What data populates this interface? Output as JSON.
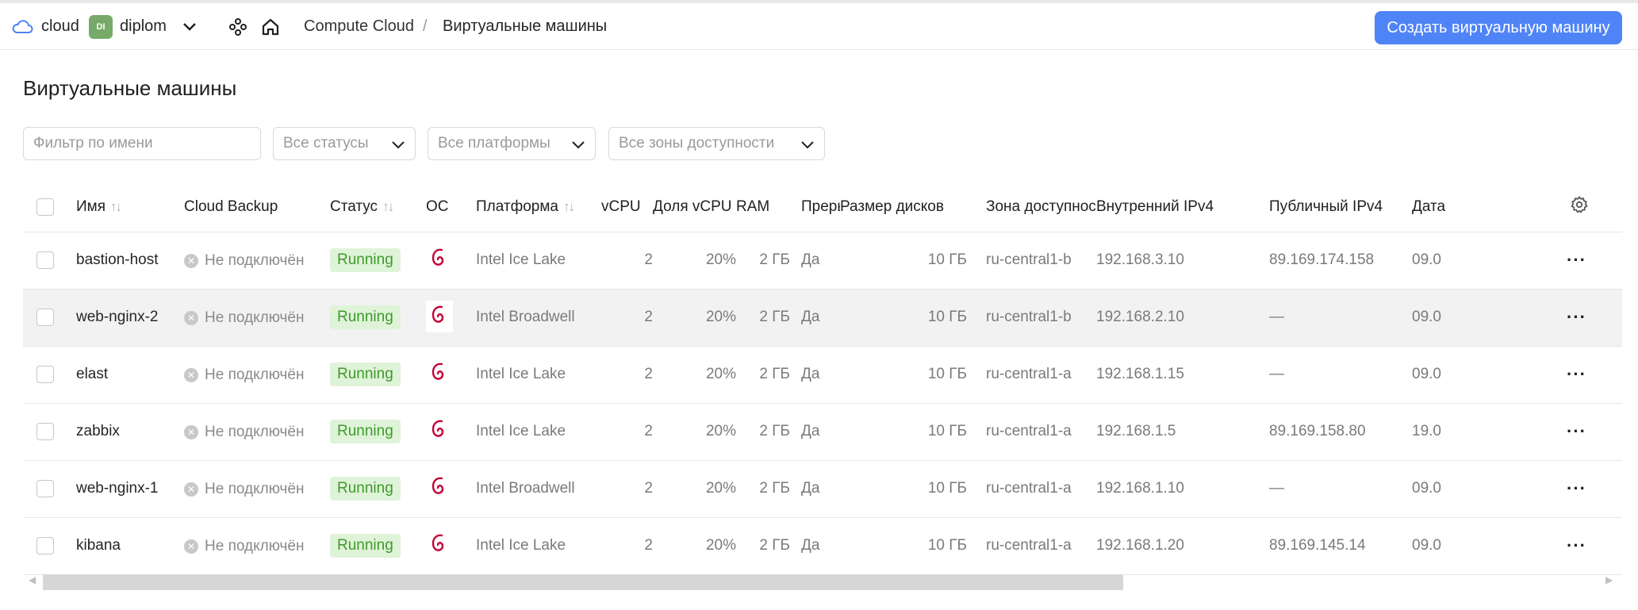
{
  "header": {
    "cloud_label": "cloud",
    "folder_badge": "DI",
    "folder_label": "diplom",
    "breadcrumb_service": "Compute Cloud",
    "breadcrumb_sep": "/",
    "breadcrumb_current": "Виртуальные машины",
    "create_button": "Создать виртуальную машину"
  },
  "page": {
    "title": "Виртуальные машины"
  },
  "filters": {
    "name_placeholder": "Фильтр по имени",
    "status": "Все статусы",
    "platform": "Все платформы",
    "zone": "Все зоны доступности"
  },
  "table": {
    "columns": {
      "name": "Имя",
      "backup": "Cloud Backup",
      "status": "Статус",
      "os": "ОС",
      "platform": "Платформа",
      "vcpu": "vCPU",
      "vcpu_share": "Доля vCPU",
      "ram": "RAM",
      "preemptible": "Прерываемая",
      "disk": "Размер дисков",
      "zone": "Зона доступности",
      "internal_ip": "Внутренний IPv4",
      "public_ip": "Публичный IPv4",
      "date": "Дата"
    },
    "rows": [
      {
        "name": "bastion-host",
        "backup": "Не подключён",
        "status": "Running",
        "platform": "Intel Ice Lake",
        "vcpu": "2",
        "share": "20%",
        "ram": "2 ГБ",
        "preempt": "Да",
        "disk": "10 ГБ",
        "zone": "ru-central1-b",
        "internal_ip": "192.168.3.10",
        "public_ip": "89.169.174.158",
        "date": "09.0"
      },
      {
        "name": "web-nginx-2",
        "backup": "Не подключён",
        "status": "Running",
        "platform": "Intel Broadwell",
        "vcpu": "2",
        "share": "20%",
        "ram": "2 ГБ",
        "preempt": "Да",
        "disk": "10 ГБ",
        "zone": "ru-central1-b",
        "internal_ip": "192.168.2.10",
        "public_ip": "—",
        "date": "09.0"
      },
      {
        "name": "elast",
        "backup": "Не подключён",
        "status": "Running",
        "platform": "Intel Ice Lake",
        "vcpu": "2",
        "share": "20%",
        "ram": "2 ГБ",
        "preempt": "Да",
        "disk": "10 ГБ",
        "zone": "ru-central1-a",
        "internal_ip": "192.168.1.15",
        "public_ip": "—",
        "date": "09.0"
      },
      {
        "name": "zabbix",
        "backup": "Не подключён",
        "status": "Running",
        "platform": "Intel Ice Lake",
        "vcpu": "2",
        "share": "20%",
        "ram": "2 ГБ",
        "preempt": "Да",
        "disk": "10 ГБ",
        "zone": "ru-central1-a",
        "internal_ip": "192.168.1.5",
        "public_ip": "89.169.158.80",
        "date": "19.0"
      },
      {
        "name": "web-nginx-1",
        "backup": "Не подключён",
        "status": "Running",
        "platform": "Intel Broadwell",
        "vcpu": "2",
        "share": "20%",
        "ram": "2 ГБ",
        "preempt": "Да",
        "disk": "10 ГБ",
        "zone": "ru-central1-a",
        "internal_ip": "192.168.1.10",
        "public_ip": "—",
        "date": "09.0"
      },
      {
        "name": "kibana",
        "backup": "Не подключён",
        "status": "Running",
        "platform": "Intel Ice Lake",
        "vcpu": "2",
        "share": "20%",
        "ram": "2 ГБ",
        "preempt": "Да",
        "disk": "10 ГБ",
        "zone": "ru-central1-a",
        "internal_ip": "192.168.1.20",
        "public_ip": "89.169.145.14",
        "date": "09.0"
      }
    ]
  },
  "icons": {
    "cloud": "cloud-icon",
    "chevron": "chevron-down-icon",
    "services": "services-icon",
    "home": "home-icon",
    "os": "debian-icon",
    "settings": "gear-icon",
    "more": "more-dots-icon"
  },
  "colors": {
    "accent": "#4f84f6",
    "status_bg": "#dff3d8",
    "status_text": "#3e9a2c",
    "debian": "#c70036",
    "folder_badge": "#77a968"
  }
}
